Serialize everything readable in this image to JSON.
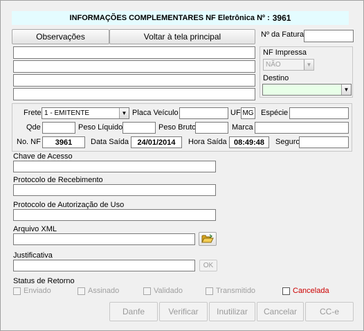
{
  "title": {
    "label": "INFORMAÇÕES COMPLEMENTARES  NF Eletrônica Nº :",
    "number": "3961"
  },
  "buttons": {
    "observacoes": "Observações",
    "voltar": "Voltar à tela principal",
    "ok": "OK"
  },
  "fatura": {
    "label": "Nº da Fatura",
    "value": ""
  },
  "nf_impressa": {
    "label": "NF Impressa",
    "value": "NÃO"
  },
  "destino": {
    "label": "Destino",
    "value": ""
  },
  "frete": {
    "label": "Frete",
    "value": "1 - EMITENTE"
  },
  "placa": {
    "label": "Placa Veículo",
    "value": ""
  },
  "uf": {
    "label": "UF",
    "value": "MG"
  },
  "especie": {
    "label": "Espécie",
    "value": ""
  },
  "qde": {
    "label": "Qde",
    "value": ""
  },
  "peso_liquido": {
    "label": "Peso Líquido",
    "value": ""
  },
  "peso_bruto": {
    "label": "Peso Bruto",
    "value": ""
  },
  "marca": {
    "label": "Marca",
    "value": ""
  },
  "no_nf": {
    "label": "No. NF",
    "value": "3961"
  },
  "data_saida": {
    "label": "Data Saída",
    "value": "24/01/2014"
  },
  "hora_saida": {
    "label": "Hora Saída",
    "value": "08:49:48"
  },
  "seguro": {
    "label": "Seguro",
    "value": ""
  },
  "chave": {
    "label": "Chave de Acesso",
    "value": ""
  },
  "protocolo_receb": {
    "label": "Protocolo de Recebimento",
    "value": ""
  },
  "protocolo_aut": {
    "label": "Protocolo de Autorização de Uso",
    "value": ""
  },
  "arquivo_xml": {
    "label": "Arquivo XML",
    "value": ""
  },
  "justificativa": {
    "label": "Justificativa",
    "value": ""
  },
  "status": {
    "label": "Status de Retorno",
    "items": [
      "Enviado",
      "Assinado",
      "Validado",
      "Transmitido",
      "Cancelada"
    ]
  },
  "actions": [
    "Danfe",
    "Verificar",
    "Inutilizar",
    "Cancelar",
    "CC-e"
  ],
  "colors": {
    "title_bg": "#e4fcff",
    "cancelada": "#cc0000"
  },
  "icons": {
    "folder": "folder-open-icon",
    "dropdown": "chevron-down-icon"
  }
}
